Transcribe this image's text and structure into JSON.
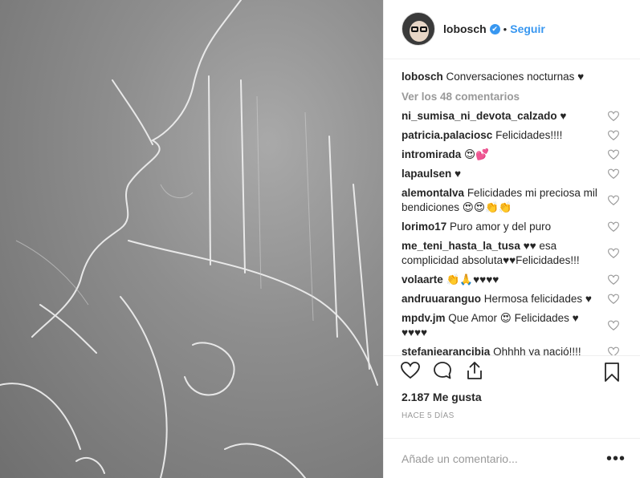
{
  "post": {
    "username": "lobosch",
    "verified_mark": "✔",
    "separator": "•",
    "follow_label": "Seguir",
    "caption_user": "lobosch",
    "caption_text": "Conversaciones nocturnas ♥",
    "view_comments": "Ver los 48 comentarios",
    "likes": "2.187 Me gusta",
    "timestamp": "HACE 5 DÍAS",
    "comment_placeholder": "Añade un comentario...",
    "options_label": "•••"
  },
  "comments": [
    {
      "user": "ni_sumisa_ni_devota_calzado",
      "text": "♥"
    },
    {
      "user": "patricia.palaciosc",
      "text": "Felicidades!!!!"
    },
    {
      "user": "intromirada",
      "text": "😍💕"
    },
    {
      "user": "lapaulsen",
      "text": "♥"
    },
    {
      "user": "alemontalva",
      "text": "Felicidades mi preciosa mil bendiciones 😍😍👏👏"
    },
    {
      "user": "lorimo17",
      "text": "Puro amor y del puro"
    },
    {
      "user": "me_teni_hasta_la_tusa",
      "text": "♥♥ esa complicidad absoluta♥♥Felicidades!!!"
    },
    {
      "user": "volaarte",
      "text": "👏🙏♥♥♥♥"
    },
    {
      "user": "andruuaranguo",
      "text": "Hermosa felicidades ♥"
    },
    {
      "user": "mpdv.jm",
      "text": "Que Amor 😍 Felicidades ♥ ♥♥♥♥"
    },
    {
      "user": "stefaniearancibia",
      "text": "Ohhhh ya nació!!!!"
    }
  ],
  "icons": {
    "like": "heart-outline-icon",
    "comment": "speech-bubble-icon",
    "share": "share-icon",
    "save": "bookmark-icon"
  },
  "colors": {
    "accent": "#3897f0",
    "muted": "#999999",
    "text": "#262626"
  }
}
